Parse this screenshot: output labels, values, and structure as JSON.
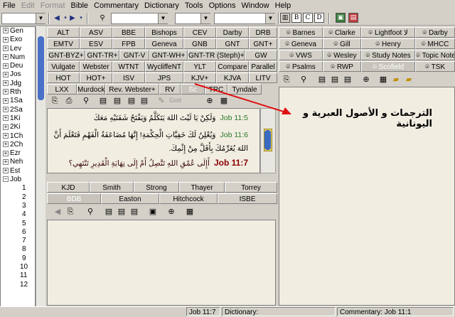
{
  "menu": [
    "File",
    "Edit",
    "Format",
    "Bible",
    "Commentary",
    "Dictionary",
    "Tools",
    "Options",
    "Window",
    "Help"
  ],
  "toolbar": {
    "reference_value": "",
    "search_value": "",
    "combo3_value": "",
    "combo4_value": "",
    "style_buttons": [
      "B",
      "C",
      "D"
    ]
  },
  "tree": {
    "books": [
      "Gen",
      "Exo",
      "Lev",
      "Num",
      "Deu",
      "Jos",
      "Jdg",
      "Rth",
      "1Sa",
      "2Sa",
      "1Ki",
      "2Ki",
      "1Ch",
      "2Ch",
      "Ezr",
      "Neh",
      "Est",
      "Job"
    ],
    "chapters": [
      "1",
      "2",
      "3",
      "4",
      "5",
      "6",
      "7",
      "8",
      "9",
      "10",
      "11",
      "12"
    ]
  },
  "bible_tabs": {
    "row1": [
      "ALT",
      "ASV",
      "BBE",
      "Bishops",
      "CEV",
      "Darby",
      "DRB"
    ],
    "row2": [
      "EMTV",
      "ESV",
      "FPB",
      "Geneva",
      "GNB",
      "GNT",
      "GNT+"
    ],
    "row3": [
      "GNT-BYZ+",
      "GNT-TR+",
      "GNT-V",
      "GNT-WH+",
      "GNT-TR (Steph)+",
      "GW"
    ],
    "row4": [
      "Vulgate",
      "Webster",
      "WTNT",
      "WycliffeNT",
      "YLT",
      "Compare",
      "Parallel"
    ],
    "row5": [
      "HOT",
      "HOT+",
      "ISV",
      "JPS",
      "KJV+",
      "KJVA",
      "LITV"
    ],
    "row6": [
      "LXX",
      "Murdock",
      "Rev. Webster+",
      "RV",
      "Sc",
      "TRC",
      "Tyndale"
    ],
    "selected": "Sc"
  },
  "bible_toolbar": {
    "god_label": "God"
  },
  "verses": [
    {
      "ref": "Job 11:5",
      "text": "وَلَكِنْ يَا لَيْتَ اللهَ يَتَكَلَّمُ وَيَفْتَحُ شَفَتَيْهِ مَعَكَ"
    },
    {
      "ref": "Job 11:6",
      "text": "وَيُعْلِنُ لَكَ خَفِيَّاتِ الْحِكْمَةِ! إِنَّهَا مُضَاعَفَةُ الْفَهْمِ فَتَعْلَمَ أَنَّ اللهَ يُغَرِّمُكَ بِأَقَلَّ مِنْ إِثْمِكَ."
    },
    {
      "ref": "Job 11:7",
      "text": "أَإِلَى عُمْقِ اللهِ تَتَّصِلُ أَمْ إِلَى نِهَايَةِ الْقَدِيرِ تَنْتَهِي؟"
    }
  ],
  "dict_tabs": {
    "row1": [
      "KJD",
      "Smith",
      "Strong",
      "Thayer",
      "Torrey"
    ],
    "row2": [
      "BDB",
      "Easton",
      "Hitchcock",
      "ISBE"
    ],
    "selected": "BDB"
  },
  "comm_tabs": {
    "row1": [
      "Barnes",
      "Clarke",
      "Lightfoot لا",
      "Darby"
    ],
    "row2": [
      "Geneva",
      "Gill",
      "Henry",
      "MHCC"
    ],
    "row3": [
      "VWS",
      "Wesley",
      "Study Notes",
      "Topic Notes"
    ],
    "row4": [
      "Psalms",
      "RWP",
      "Scofield",
      "TSK"
    ],
    "selected": "Scofield"
  },
  "annotation": {
    "text": "الترجمات و الأصول العبرية و اليونانية",
    "color": "#e01010"
  },
  "status": {
    "ref": "Job 11:7",
    "dictionary": "Dictionary:",
    "commentary": "Commentary: Job 11:1"
  }
}
